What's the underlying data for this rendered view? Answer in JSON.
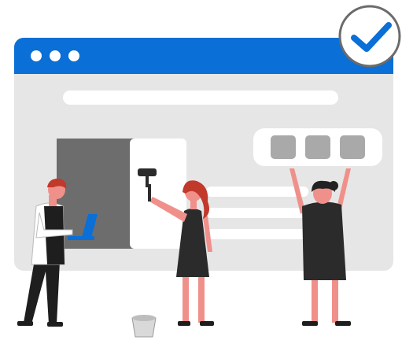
{
  "window": {
    "titlebar_color": "#0a6fd6",
    "frame_color": "#e6e6e6",
    "controls": [
      "dot-1",
      "dot-2",
      "dot-3"
    ]
  },
  "badge": {
    "icon": "checkmark-icon",
    "ring_color": "#6b6b6b",
    "check_color": "#0a6fd6"
  },
  "tiles": [
    "tile-1",
    "tile-2",
    "tile-3"
  ],
  "people": [
    {
      "role": "person-with-laptop",
      "prop": "laptop-icon"
    },
    {
      "role": "person-painting",
      "prop": "paint-roller-icon"
    },
    {
      "role": "person-lifting-tiles"
    }
  ],
  "props": {
    "paint_bucket": "paint-bucket-icon"
  },
  "colors": {
    "skin": "#f0908a",
    "hair": "#c0392b",
    "hair_dark": "#222222",
    "clothing": "#2b2b2b",
    "accent_blue": "#0a6fd6",
    "panel_dark": "#6d6d6d",
    "tile_gray": "#a9a9a9"
  }
}
